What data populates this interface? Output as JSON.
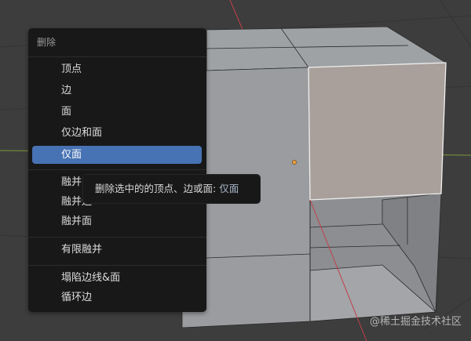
{
  "menu": {
    "title": "删除",
    "items": [
      {
        "label": "顶点"
      },
      {
        "label": "边"
      },
      {
        "label": "面"
      },
      {
        "label": "仅边和面"
      },
      {
        "label": "仅面",
        "active": true
      },
      {
        "label": "融并"
      },
      {
        "label": "融并边"
      },
      {
        "label": "融并面"
      },
      {
        "label": "有限融并"
      },
      {
        "label": "塌陷边线&面"
      },
      {
        "label": "循环边"
      }
    ]
  },
  "tooltip": {
    "text": "删除选中的的顶点、边或面:",
    "value": "仅面"
  },
  "watermark": "@稀土掘金技术社区",
  "colors": {
    "highlight": "#4772b3",
    "selected_face": "#a9a09b",
    "x_axis": "#c0404a",
    "y_axis": "#7a9a3a",
    "origin": "#f0a040"
  }
}
